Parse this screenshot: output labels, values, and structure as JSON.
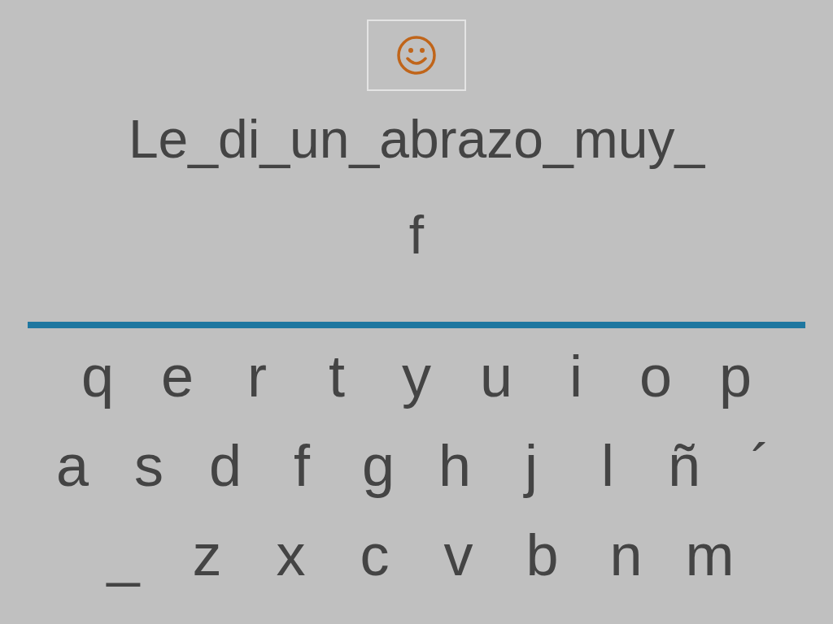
{
  "prompt": {
    "sentence": "Le_di_un_abrazo_muy_"
  },
  "answer": {
    "value": "f"
  },
  "keyboard": {
    "rows": [
      [
        "q",
        "e",
        "r",
        "t",
        "y",
        "u",
        "i",
        "o",
        "p"
      ],
      [
        "a",
        "s",
        "d",
        "f",
        "g",
        "h",
        "j",
        "l",
        "ñ",
        "´"
      ],
      [
        "_",
        "z",
        "x",
        "c",
        "v",
        "b",
        "n",
        "m"
      ]
    ]
  }
}
